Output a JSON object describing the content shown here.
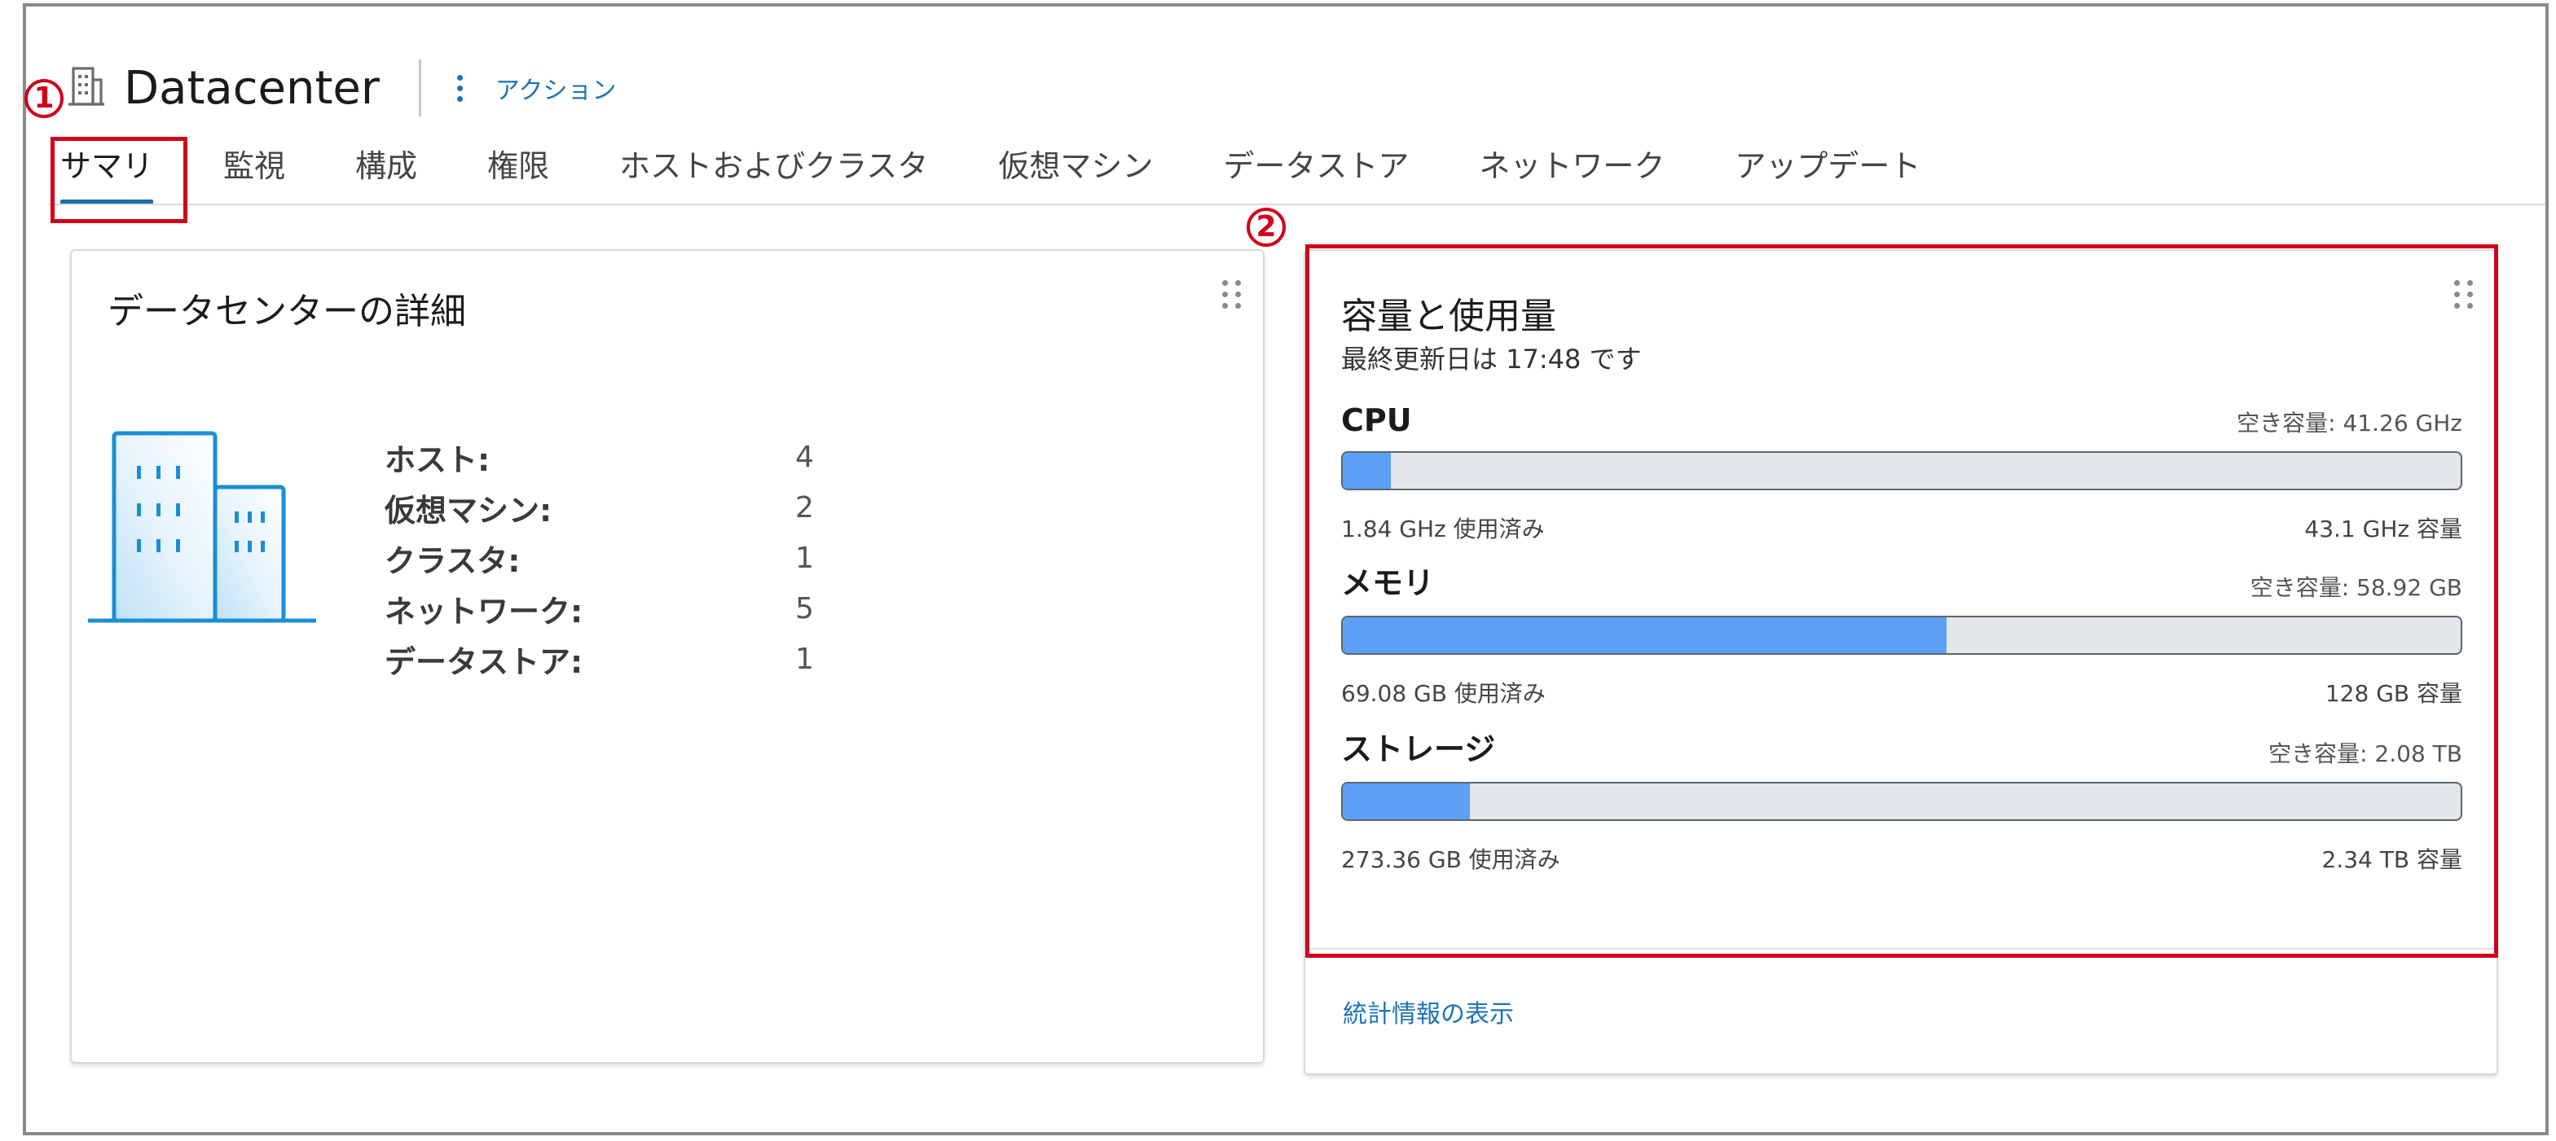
{
  "header": {
    "title": "Datacenter",
    "actions_label": "アクション"
  },
  "markers": {
    "one": "1",
    "two": "2"
  },
  "tabs": [
    {
      "label": "サマリ",
      "active": true
    },
    {
      "label": "監視"
    },
    {
      "label": "構成"
    },
    {
      "label": "権限"
    },
    {
      "label": "ホストおよびクラスタ"
    },
    {
      "label": "仮想マシン"
    },
    {
      "label": "データストア"
    },
    {
      "label": "ネットワーク"
    },
    {
      "label": "アップデート"
    }
  ],
  "details_card": {
    "title": "データセンターの詳細",
    "rows": [
      {
        "label": "ホスト:",
        "value": "4"
      },
      {
        "label": "仮想マシン:",
        "value": "2"
      },
      {
        "label": "クラスタ:",
        "value": "1"
      },
      {
        "label": "ネットワーク:",
        "value": "5"
      },
      {
        "label": "データストア:",
        "value": "1"
      }
    ]
  },
  "capacity_card": {
    "title": "容量と使用量",
    "updated": "最終更新日は 17:48 です",
    "resources": [
      {
        "name": "CPU",
        "free": "空き容量: 41.26 GHz",
        "used": "1.84 GHz 使用済み",
        "capacity": "43.1 GHz 容量",
        "usage_fraction": 0.043
      },
      {
        "name": "メモリ",
        "free": "空き容量: 58.92 GB",
        "used": "69.08 GB 使用済み",
        "capacity": "128 GB 容量",
        "usage_fraction": 0.54
      },
      {
        "name": "ストレージ",
        "free": "空き容量: 2.08 TB",
        "used": "273.36 GB 使用済み",
        "capacity": "2.34 TB 容量",
        "usage_fraction": 0.114
      }
    ],
    "stats_link": "統計情報の表示"
  },
  "colors": {
    "accent": "#1a73b8",
    "bar_fill": "#5ea0f6",
    "bar_track": "#e3e7ea",
    "annotation": "#d0021b"
  }
}
